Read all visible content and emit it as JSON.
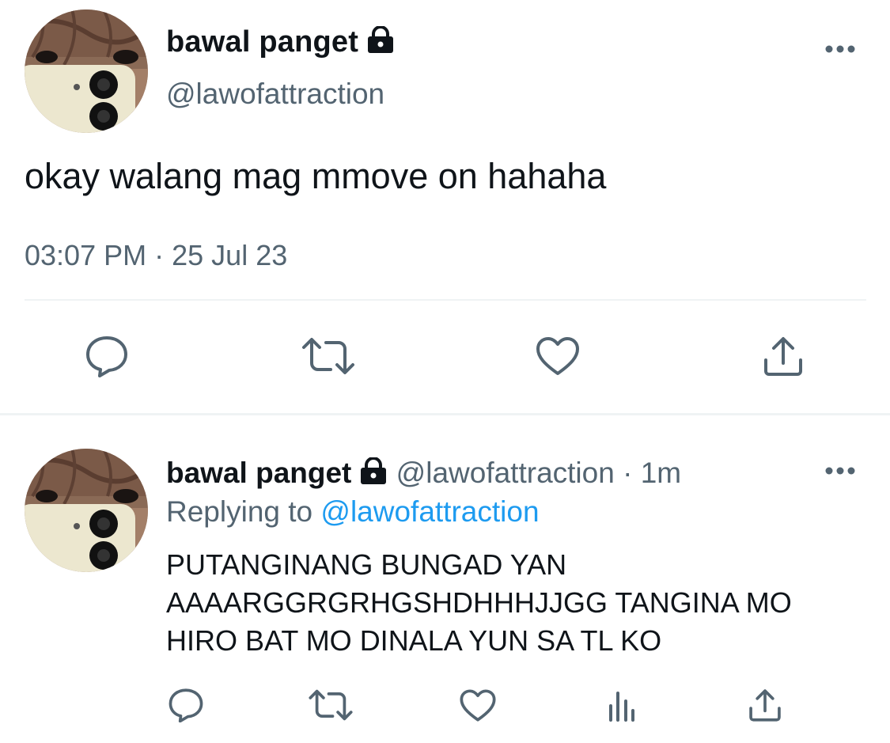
{
  "tweet": {
    "display_name": "bawal panget",
    "handle": "@lawofattraction",
    "text": "okay walang mag mmove on hahaha",
    "time": "03:07 PM",
    "separator": "·",
    "date": "25 Jul 23",
    "actions": [
      "reply-icon",
      "retweet-icon",
      "like-icon",
      "share-icon"
    ]
  },
  "reply": {
    "display_name": "bawal panget",
    "handle": "@lawofattraction",
    "separator": "·",
    "age": "1m",
    "replying_prefix": "Replying to",
    "replying_to": "@lawofattraction",
    "lines": [
      "PUTANGINANG BUNGAD YAN",
      "AAAARGGRGRHGSHDHHHJJGG TANGINA MO",
      "HIRO BAT MO DINALA YUN SA TL KO"
    ],
    "actions": [
      "reply-icon",
      "retweet-icon",
      "like-icon",
      "views-icon",
      "share-icon"
    ]
  },
  "colors": {
    "text": "#0f1419",
    "secondary": "#536471",
    "link": "#1d9bf0",
    "divider": "#eff3f4"
  }
}
